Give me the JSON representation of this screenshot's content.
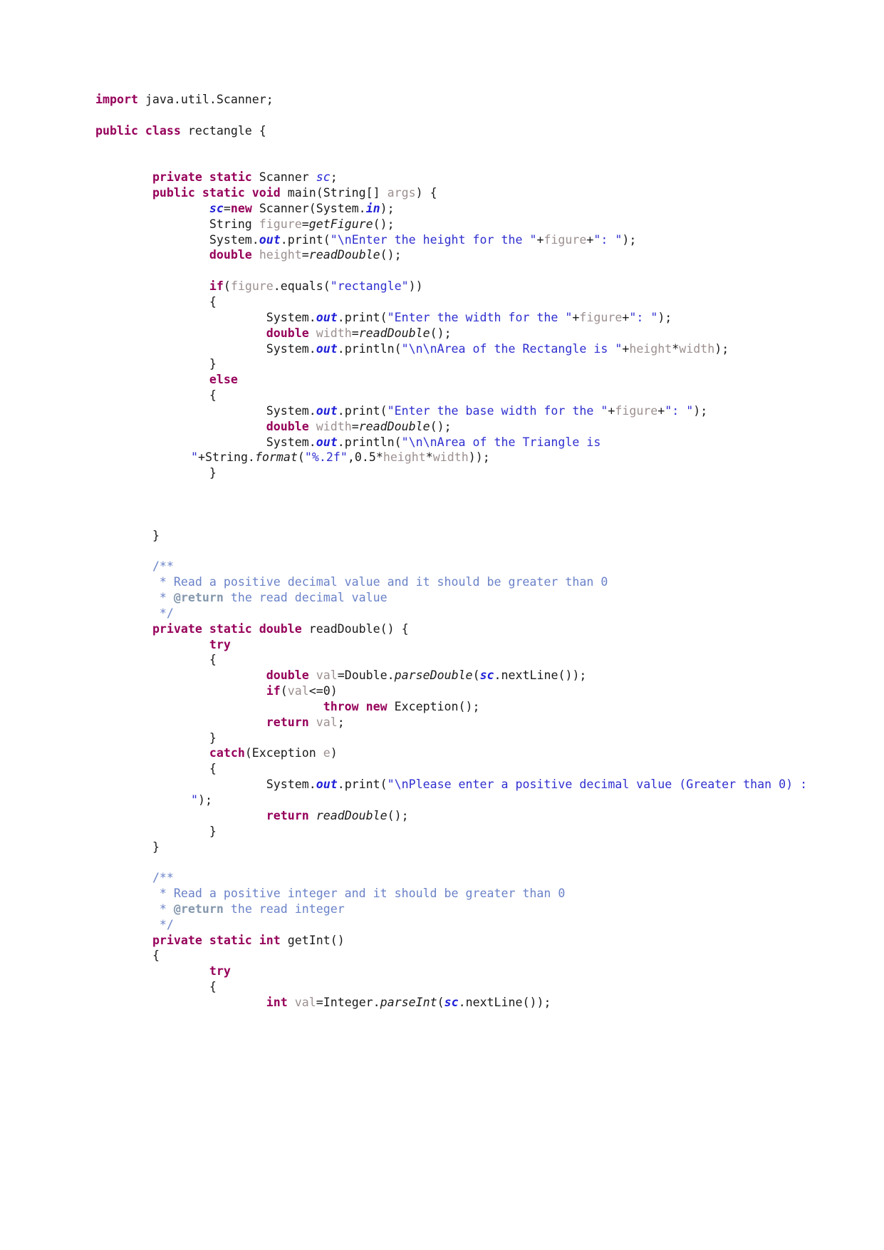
{
  "document": {
    "kind": "java-source-listing",
    "class_name": "rectangle",
    "page_background": "#ffffff",
    "colors": {
      "keyword": "#96005a",
      "string": "#2f2fd0",
      "comment": "#6a82c8",
      "javadoc_tag": "#8497ad",
      "static_field": "#2020d8",
      "local_variable": "#9d9090",
      "method_name": "#1a1a1a",
      "plain_text": "#1a1a1a"
    }
  },
  "code": {
    "lines": [
      {
        "id": "l1",
        "indent": 0,
        "tokens": [
          {
            "t": "kw",
            "v": "import"
          },
          {
            "t": "pln",
            "v": " java.util.Scanner;"
          }
        ]
      },
      {
        "id": "l2",
        "indent": 0,
        "tokens": []
      },
      {
        "id": "l3",
        "indent": 0,
        "tokens": [
          {
            "t": "kw",
            "v": "public class"
          },
          {
            "t": "pln",
            "v": " rectangle {"
          }
        ]
      },
      {
        "id": "l4",
        "indent": 0,
        "tokens": []
      },
      {
        "id": "l5",
        "indent": 0,
        "tokens": []
      },
      {
        "id": "l6",
        "indent": 1,
        "tokens": [
          {
            "t": "kw",
            "v": "private static"
          },
          {
            "t": "pln",
            "v": " Scanner "
          },
          {
            "t": "fld",
            "v": "sc"
          },
          {
            "t": "pln",
            "v": ";"
          }
        ]
      },
      {
        "id": "l7",
        "indent": 1,
        "tokens": [
          {
            "t": "kw",
            "v": "public static void"
          },
          {
            "t": "pln",
            "v": " main(String[] "
          },
          {
            "t": "var",
            "v": "args"
          },
          {
            "t": "pln",
            "v": ") {"
          }
        ]
      },
      {
        "id": "l8",
        "indent": 2,
        "tokens": [
          {
            "t": "sfld",
            "v": "sc"
          },
          {
            "t": "pln",
            "v": "="
          },
          {
            "t": "kw",
            "v": "new"
          },
          {
            "t": "pln",
            "v": " Scanner(System."
          },
          {
            "t": "sfld",
            "v": "in"
          },
          {
            "t": "pln",
            "v": ");"
          }
        ]
      },
      {
        "id": "l9",
        "indent": 2,
        "tokens": [
          {
            "t": "pln",
            "v": "String "
          },
          {
            "t": "var",
            "v": "figure"
          },
          {
            "t": "pln",
            "v": "="
          },
          {
            "t": "mth",
            "v": "getFigure"
          },
          {
            "t": "pln",
            "v": "();"
          }
        ]
      },
      {
        "id": "l10",
        "indent": 2,
        "tokens": [
          {
            "t": "pln",
            "v": "System."
          },
          {
            "t": "sfld",
            "v": "out"
          },
          {
            "t": "pln",
            "v": ".print("
          },
          {
            "t": "str",
            "v": "\"\\nEnter the height for the \""
          },
          {
            "t": "pln",
            "v": "+"
          },
          {
            "t": "var",
            "v": "figure"
          },
          {
            "t": "pln",
            "v": "+"
          },
          {
            "t": "str",
            "v": "\": \""
          },
          {
            "t": "pln",
            "v": ");"
          }
        ]
      },
      {
        "id": "l11",
        "indent": 2,
        "tokens": [
          {
            "t": "kw",
            "v": "double"
          },
          {
            "t": "pln",
            "v": " "
          },
          {
            "t": "var",
            "v": "height"
          },
          {
            "t": "pln",
            "v": "="
          },
          {
            "t": "mth",
            "v": "readDouble"
          },
          {
            "t": "pln",
            "v": "();"
          }
        ]
      },
      {
        "id": "l12",
        "indent": 0,
        "tokens": []
      },
      {
        "id": "l13",
        "indent": 2,
        "tokens": [
          {
            "t": "kw",
            "v": "if"
          },
          {
            "t": "pln",
            "v": "("
          },
          {
            "t": "var",
            "v": "figure"
          },
          {
            "t": "pln",
            "v": ".equals("
          },
          {
            "t": "str",
            "v": "\"rectangle\""
          },
          {
            "t": "pln",
            "v": "))"
          }
        ]
      },
      {
        "id": "l14",
        "indent": 2,
        "tokens": [
          {
            "t": "pln",
            "v": "{"
          }
        ]
      },
      {
        "id": "l15",
        "indent": 3,
        "tokens": [
          {
            "t": "pln",
            "v": "System."
          },
          {
            "t": "sfld",
            "v": "out"
          },
          {
            "t": "pln",
            "v": ".print("
          },
          {
            "t": "str",
            "v": "\"Enter the width for the \""
          },
          {
            "t": "pln",
            "v": "+"
          },
          {
            "t": "var",
            "v": "figure"
          },
          {
            "t": "pln",
            "v": "+"
          },
          {
            "t": "str",
            "v": "\": \""
          },
          {
            "t": "pln",
            "v": ");"
          }
        ]
      },
      {
        "id": "l16",
        "indent": 3,
        "tokens": [
          {
            "t": "kw",
            "v": "double"
          },
          {
            "t": "pln",
            "v": " "
          },
          {
            "t": "var",
            "v": "width"
          },
          {
            "t": "pln",
            "v": "="
          },
          {
            "t": "mth",
            "v": "readDouble"
          },
          {
            "t": "pln",
            "v": "();"
          }
        ]
      },
      {
        "id": "l17",
        "indent": 3,
        "tokens": [
          {
            "t": "pln",
            "v": "System."
          },
          {
            "t": "sfld",
            "v": "out"
          },
          {
            "t": "pln",
            "v": ".println("
          },
          {
            "t": "str",
            "v": "\"\\n\\nArea of the Rectangle is \""
          },
          {
            "t": "pln",
            "v": "+"
          },
          {
            "t": "var",
            "v": "height"
          },
          {
            "t": "pln",
            "v": "*"
          },
          {
            "t": "var",
            "v": "width"
          },
          {
            "t": "pln",
            "v": ");"
          }
        ]
      },
      {
        "id": "l18",
        "indent": 2,
        "tokens": [
          {
            "t": "pln",
            "v": "}"
          }
        ]
      },
      {
        "id": "l19",
        "indent": 2,
        "tokens": [
          {
            "t": "kw",
            "v": "else"
          }
        ]
      },
      {
        "id": "l20",
        "indent": 2,
        "tokens": [
          {
            "t": "pln",
            "v": "{"
          }
        ]
      },
      {
        "id": "l21",
        "indent": 3,
        "tokens": [
          {
            "t": "pln",
            "v": "System."
          },
          {
            "t": "sfld",
            "v": "out"
          },
          {
            "t": "pln",
            "v": ".print("
          },
          {
            "t": "str",
            "v": "\"Enter the base width for the \""
          },
          {
            "t": "pln",
            "v": "+"
          },
          {
            "t": "var",
            "v": "figure"
          },
          {
            "t": "pln",
            "v": "+"
          },
          {
            "t": "str",
            "v": "\": \""
          },
          {
            "t": "pln",
            "v": ");"
          }
        ]
      },
      {
        "id": "l22",
        "indent": 3,
        "tokens": [
          {
            "t": "kw",
            "v": "double"
          },
          {
            "t": "pln",
            "v": " "
          },
          {
            "t": "var",
            "v": "width"
          },
          {
            "t": "pln",
            "v": "="
          },
          {
            "t": "mth",
            "v": "readDouble"
          },
          {
            "t": "pln",
            "v": "();"
          }
        ]
      },
      {
        "id": "l23",
        "indent": 3,
        "tokens": [
          {
            "t": "pln",
            "v": "System."
          },
          {
            "t": "sfld",
            "v": "out"
          },
          {
            "t": "pln",
            "v": ".println("
          },
          {
            "t": "str",
            "v": "\"\\n\\nArea of the Triangle is \""
          },
          {
            "t": "pln",
            "v": "+String."
          },
          {
            "t": "mth",
            "v": "format"
          },
          {
            "t": "pln",
            "v": "("
          },
          {
            "t": "str",
            "v": "\"%.2f\""
          },
          {
            "t": "pln",
            "v": ","
          },
          {
            "t": "num",
            "v": "0.5"
          },
          {
            "t": "pln",
            "v": "*"
          },
          {
            "t": "var",
            "v": "height"
          },
          {
            "t": "pln",
            "v": "*"
          },
          {
            "t": "var",
            "v": "width"
          },
          {
            "t": "pln",
            "v": "));"
          }
        ]
      },
      {
        "id": "l24",
        "indent": 2,
        "tokens": [
          {
            "t": "pln",
            "v": "}"
          }
        ]
      },
      {
        "id": "l25",
        "indent": 0,
        "tokens": []
      },
      {
        "id": "l26",
        "indent": 0,
        "tokens": []
      },
      {
        "id": "l27",
        "indent": 0,
        "tokens": []
      },
      {
        "id": "l28",
        "indent": 1,
        "tokens": [
          {
            "t": "pln",
            "v": "}"
          }
        ]
      },
      {
        "id": "l29",
        "indent": 0,
        "tokens": []
      },
      {
        "id": "l30",
        "indent": 1,
        "tokens": [
          {
            "t": "cmt",
            "v": "/**"
          }
        ]
      },
      {
        "id": "l31",
        "indent": 1,
        "tokens": [
          {
            "t": "cmt",
            "v": " * Read a positive decimal value and it should be greater than 0"
          }
        ]
      },
      {
        "id": "l32",
        "indent": 1,
        "tokens": [
          {
            "t": "cmt",
            "v": " * "
          },
          {
            "t": "tag",
            "v": "@return"
          },
          {
            "t": "cmt",
            "v": " the read decimal value"
          }
        ]
      },
      {
        "id": "l33",
        "indent": 1,
        "tokens": [
          {
            "t": "cmt",
            "v": " */"
          }
        ]
      },
      {
        "id": "l34",
        "indent": 1,
        "tokens": [
          {
            "t": "kw",
            "v": "private static double"
          },
          {
            "t": "pln",
            "v": " readDouble() {"
          }
        ]
      },
      {
        "id": "l35",
        "indent": 2,
        "tokens": [
          {
            "t": "kw",
            "v": "try"
          }
        ]
      },
      {
        "id": "l36",
        "indent": 2,
        "tokens": [
          {
            "t": "pln",
            "v": "{"
          }
        ]
      },
      {
        "id": "l37",
        "indent": 3,
        "tokens": [
          {
            "t": "kw",
            "v": "double"
          },
          {
            "t": "pln",
            "v": " "
          },
          {
            "t": "var",
            "v": "val"
          },
          {
            "t": "pln",
            "v": "=Double."
          },
          {
            "t": "mth",
            "v": "parseDouble"
          },
          {
            "t": "pln",
            "v": "("
          },
          {
            "t": "sfld",
            "v": "sc"
          },
          {
            "t": "pln",
            "v": ".nextLine());"
          }
        ]
      },
      {
        "id": "l38",
        "indent": 3,
        "tokens": [
          {
            "t": "kw",
            "v": "if"
          },
          {
            "t": "pln",
            "v": "("
          },
          {
            "t": "var",
            "v": "val"
          },
          {
            "t": "pln",
            "v": "<="
          },
          {
            "t": "num",
            "v": "0"
          },
          {
            "t": "pln",
            "v": ")"
          }
        ]
      },
      {
        "id": "l39",
        "indent": 4,
        "tokens": [
          {
            "t": "kw",
            "v": "throw new"
          },
          {
            "t": "pln",
            "v": " Exception();"
          }
        ]
      },
      {
        "id": "l40",
        "indent": 3,
        "tokens": [
          {
            "t": "kw",
            "v": "return"
          },
          {
            "t": "pln",
            "v": " "
          },
          {
            "t": "var",
            "v": "val"
          },
          {
            "t": "pln",
            "v": ";"
          }
        ]
      },
      {
        "id": "l41",
        "indent": 2,
        "tokens": [
          {
            "t": "pln",
            "v": "}"
          }
        ]
      },
      {
        "id": "l42",
        "indent": 2,
        "tokens": [
          {
            "t": "kw",
            "v": "catch"
          },
          {
            "t": "pln",
            "v": "(Exception "
          },
          {
            "t": "var",
            "v": "e"
          },
          {
            "t": "pln",
            "v": ")"
          }
        ]
      },
      {
        "id": "l43",
        "indent": 2,
        "tokens": [
          {
            "t": "pln",
            "v": "{"
          }
        ]
      },
      {
        "id": "l44",
        "indent": 3,
        "tokens": [
          {
            "t": "pln",
            "v": "System."
          },
          {
            "t": "sfld",
            "v": "out"
          },
          {
            "t": "pln",
            "v": ".print("
          },
          {
            "t": "str",
            "v": "\"\\nPlease enter a positive decimal value (Greater than 0) : \""
          },
          {
            "t": "pln",
            "v": ");"
          }
        ]
      },
      {
        "id": "l45",
        "indent": 3,
        "tokens": [
          {
            "t": "kw",
            "v": "return"
          },
          {
            "t": "pln",
            "v": " "
          },
          {
            "t": "mth",
            "v": "readDouble"
          },
          {
            "t": "pln",
            "v": "();"
          }
        ]
      },
      {
        "id": "l46",
        "indent": 2,
        "tokens": [
          {
            "t": "pln",
            "v": "}"
          }
        ]
      },
      {
        "id": "l47",
        "indent": 1,
        "tokens": [
          {
            "t": "pln",
            "v": "}"
          }
        ]
      },
      {
        "id": "l48",
        "indent": 0,
        "tokens": []
      },
      {
        "id": "l49",
        "indent": 1,
        "tokens": [
          {
            "t": "cmt",
            "v": "/**"
          }
        ]
      },
      {
        "id": "l50",
        "indent": 1,
        "tokens": [
          {
            "t": "cmt",
            "v": " * Read a positive integer and it should be greater than 0"
          }
        ]
      },
      {
        "id": "l51",
        "indent": 1,
        "tokens": [
          {
            "t": "cmt",
            "v": " * "
          },
          {
            "t": "tag",
            "v": "@return"
          },
          {
            "t": "cmt",
            "v": " the read integer"
          }
        ]
      },
      {
        "id": "l52",
        "indent": 1,
        "tokens": [
          {
            "t": "cmt",
            "v": " */"
          }
        ]
      },
      {
        "id": "l53",
        "indent": 1,
        "tokens": [
          {
            "t": "kw",
            "v": "private static int"
          },
          {
            "t": "pln",
            "v": " getInt()"
          }
        ]
      },
      {
        "id": "l54",
        "indent": 1,
        "tokens": [
          {
            "t": "pln",
            "v": "{"
          }
        ]
      },
      {
        "id": "l55",
        "indent": 2,
        "tokens": [
          {
            "t": "kw",
            "v": "try"
          }
        ]
      },
      {
        "id": "l56",
        "indent": 2,
        "tokens": [
          {
            "t": "pln",
            "v": "{"
          }
        ]
      },
      {
        "id": "l57",
        "indent": 3,
        "tokens": [
          {
            "t": "kw",
            "v": "int"
          },
          {
            "t": "pln",
            "v": " "
          },
          {
            "t": "var",
            "v": "val"
          },
          {
            "t": "pln",
            "v": "=Integer."
          },
          {
            "t": "mth",
            "v": "parseInt"
          },
          {
            "t": "pln",
            "v": "("
          },
          {
            "t": "sfld",
            "v": "sc"
          },
          {
            "t": "pln",
            "v": ".nextLine());"
          }
        ]
      }
    ]
  }
}
